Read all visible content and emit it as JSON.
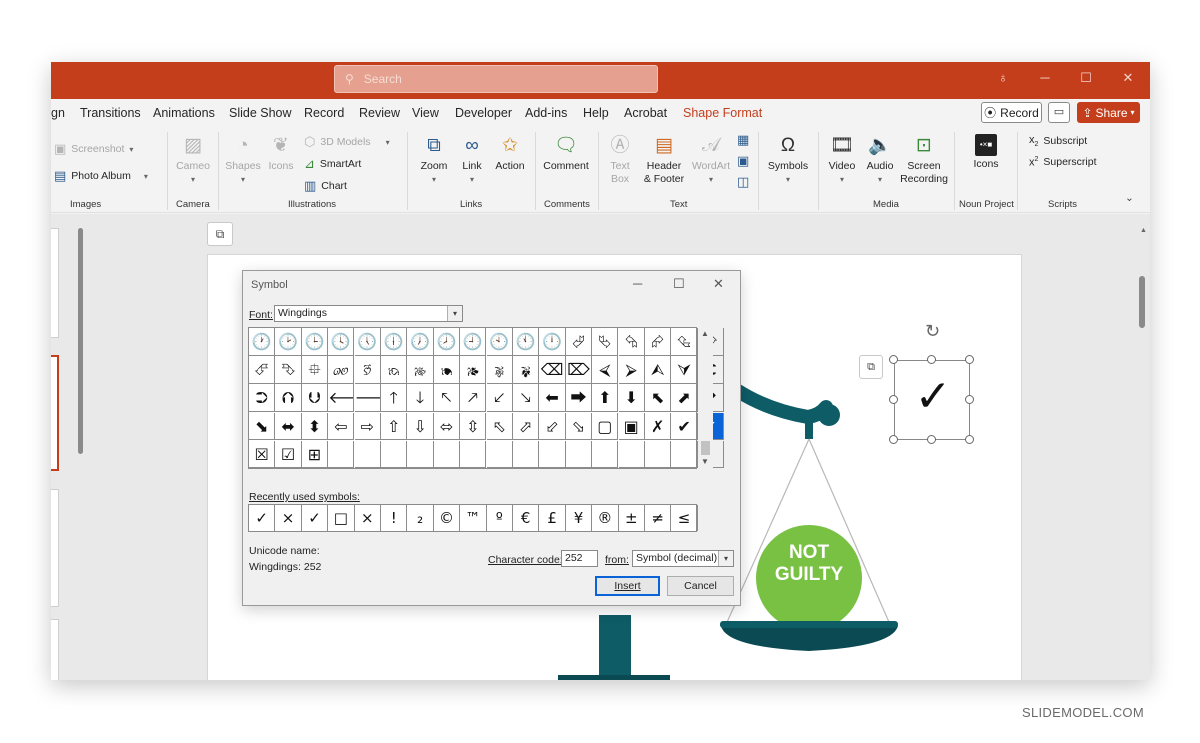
{
  "titlebar": {
    "search_placeholder": "Search",
    "search_icon": "search-icon",
    "colors": {
      "bar": "#c43e1c"
    }
  },
  "tabs": {
    "items": [
      "gn",
      "Transitions",
      "Animations",
      "Slide Show",
      "Record",
      "Review",
      "View",
      "Developer",
      "Add-ins",
      "Help",
      "Acrobat",
      "Shape Format"
    ],
    "active": "Shape Format",
    "record_label": "Record",
    "share_label": "Share"
  },
  "ribbon": {
    "images": {
      "screenshot": "Screenshot",
      "photo_album": "Photo Album",
      "label": "Images"
    },
    "camera": {
      "cameo": "Cameo",
      "label": "Camera"
    },
    "illustrations": {
      "shapes": "Shapes",
      "icons": "Icons",
      "models": "3D Models",
      "smartart": "SmartArt",
      "chart": "Chart",
      "label": "Illustrations"
    },
    "links": {
      "zoom": "Zoom",
      "link": "Link",
      "action": "Action",
      "label": "Links"
    },
    "comments": {
      "comment": "Comment",
      "label": "Comments"
    },
    "text": {
      "text_box_1": "Text",
      "text_box_2": "Box",
      "header_1": "Header",
      "header_2": "& Footer",
      "wordart": "WordArt",
      "label": "Text"
    },
    "symbols": {
      "symbols": "Symbols"
    },
    "media": {
      "video": "Video",
      "audio": "Audio",
      "screen_1": "Screen",
      "screen_2": "Recording",
      "label": "Media"
    },
    "noun_project": {
      "icons": "Icons",
      "logo": "•×■",
      "label": "Noun Project"
    },
    "scripts": {
      "subscript": "Subscript",
      "superscript": "Superscript",
      "label": "Scripts"
    }
  },
  "dialog": {
    "title": "Symbol",
    "font_label": "Font:",
    "font_value": "Wingdings",
    "grid_rows": [
      [
        "🕐",
        "🕑",
        "🕒",
        "🕓",
        "🕔",
        "🕕",
        "🕖",
        "🕗",
        "🕘",
        "🕙",
        "🕚",
        "🕛",
        "⮰",
        "⮱",
        "⮲",
        "⮳",
        "⮴",
        "⮵"
      ],
      [
        "⮶",
        "⮷",
        "⯐",
        "🙐",
        "🙑",
        "🙒",
        "🙓",
        "🙔",
        "🙕",
        "🙖",
        "🙗",
        "⌫",
        "⌦",
        "⮘",
        "⮚",
        "⮙",
        "⮛",
        "⮈"
      ],
      [
        "⮊",
        "⮉",
        "⮋",
        "🡐",
        "🡒",
        "🡑",
        "🡓",
        "🡔",
        "🡕",
        "🡗",
        "🡖",
        "⬅",
        "⮕",
        "⬆",
        "⬇",
        "⬉",
        "⬈",
        "⬋"
      ],
      [
        "⬊",
        "⬌",
        "⬍",
        "⇦",
        "⇨",
        "⇧",
        "⇩",
        "⬄",
        "⇳",
        "⬁",
        "⬀",
        "⬃",
        "⬂",
        "▢",
        "▣",
        "✗",
        "✔",
        "✓"
      ],
      [
        "☒",
        "☑",
        "⊞",
        "",
        "",
        "",
        "",
        "",
        "",
        "",
        "",
        "",
        "",
        "",
        "",
        "",
        "",
        ""
      ]
    ],
    "selected_symbol": "✓",
    "recent_label": "Recently used symbols:",
    "recent": [
      "✓",
      "×",
      "✓",
      "□",
      "×",
      "!",
      "₂",
      "©",
      "™",
      "º",
      "€",
      "£",
      "¥",
      "®",
      "±",
      "≠",
      "≤"
    ],
    "unicode_label": "Unicode name:",
    "unicode_value": "Wingdings: 252",
    "code_label": "Character code:",
    "code_value": "252",
    "from_label": "from:",
    "from_value": "Symbol (decimal)",
    "insert_label": "Insert",
    "cancel_label": "Cancel"
  },
  "slide": {
    "badge_line1": "NOT",
    "badge_line2": "GUILTY",
    "inserted_symbol": "✓",
    "colors": {
      "scale": "#0e5c66",
      "badge": "#79c143"
    }
  },
  "watermark": "SLIDEMODEL.COM"
}
